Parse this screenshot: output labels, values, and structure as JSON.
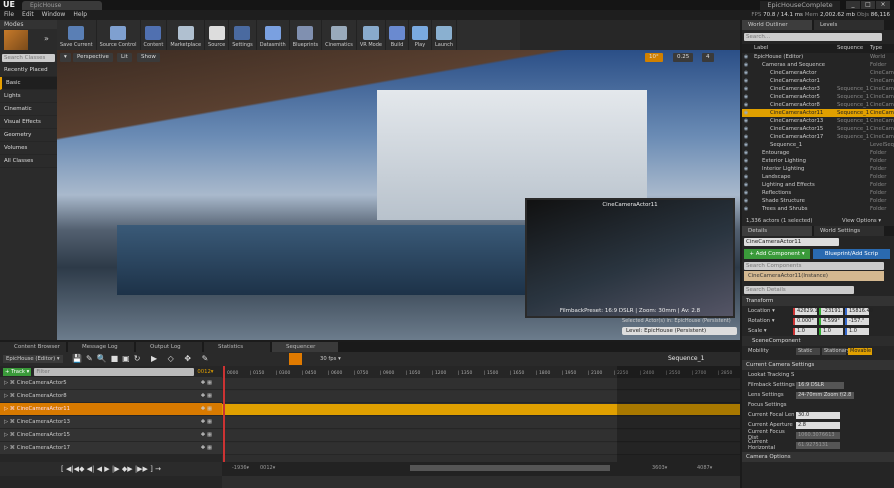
{
  "app": {
    "logo": "UE",
    "tab": "EpicHouse",
    "project": "EpicHouseComplete",
    "window_controls": [
      "_",
      "□",
      "×"
    ]
  },
  "menu": [
    "File",
    "Edit",
    "Window",
    "Help"
  ],
  "stats": {
    "fps_label": "FPS",
    "fps": "70.8 / 14.1 ms",
    "mem_label": "Mem",
    "mem": "2,002.62 mb",
    "objs_label": "Objs",
    "objs": "86,116"
  },
  "modes": {
    "title": "Modes",
    "search_placeholder": "Search Classes",
    "categories": [
      "Recently Placed",
      "Basic",
      "Lights",
      "Cinematic",
      "Visual Effects",
      "Geometry",
      "Volumes",
      "All Classes"
    ],
    "selected": "Basic"
  },
  "toolbar": [
    {
      "label": "Save Current",
      "color": "#5a7fb5"
    },
    {
      "label": "Source Control",
      "color": "#7fa0d0"
    },
    {
      "label": "Content",
      "color": "#5070b0"
    },
    {
      "label": "Marketplace",
      "color": "#b0c0d0"
    },
    {
      "label": "Source",
      "color": "#ddd"
    },
    {
      "label": "Settings",
      "color": "#4a6aa0"
    },
    {
      "label": "Datasmith",
      "color": "#7aa0e0"
    },
    {
      "label": "Blueprints",
      "color": "#8090b0"
    },
    {
      "label": "Cinematics",
      "color": "#9ab"
    },
    {
      "label": "VR Mode",
      "color": "#8ac"
    },
    {
      "label": "Build",
      "color": "#6a8ad0"
    },
    {
      "label": "Play",
      "color": "#7aaae0"
    },
    {
      "label": "Launch",
      "color": "#8ab0d0"
    }
  ],
  "viewport": {
    "menu": "▾",
    "perspective": "Perspective",
    "lit": "Lit",
    "show": "Show",
    "snap_angle": "10°",
    "scale": "0.25",
    "camera_speed": "4",
    "pip_title": "CineCameraActor11",
    "pip_info": "FilmbackPreset: 16:9 DSLR | Zoom: 30mm | Av: 2.8",
    "selected_actors": "Selected Actor(s) in: EpicHouse (Persistent)",
    "level": "Level: EpicHouse (Persistent)"
  },
  "outliner": {
    "tab": "World Outliner",
    "tab2": "Levels",
    "search_placeholder": "Search...",
    "columns": [
      "Label",
      "Sequence",
      "Type"
    ],
    "rows": [
      {
        "label": "EpicHouse (Editor)",
        "seq": "",
        "type": "World",
        "indent": 0,
        "sel": false
      },
      {
        "label": "Cameras and Sequence",
        "seq": "",
        "type": "Folder",
        "indent": 1,
        "sel": false
      },
      {
        "label": "CineCameraActor",
        "seq": "",
        "type": "CineCameraActor",
        "indent": 2,
        "sel": false
      },
      {
        "label": "CineCameraActor1",
        "seq": "",
        "type": "CineCameraActor",
        "indent": 2,
        "sel": false
      },
      {
        "label": "CineCameraActor3",
        "seq": "Sequence_1",
        "type": "CineCameraActor",
        "indent": 2,
        "sel": false
      },
      {
        "label": "CineCameraActor5",
        "seq": "Sequence_1",
        "type": "CineCameraActor",
        "indent": 2,
        "sel": false
      },
      {
        "label": "CineCameraActor8",
        "seq": "Sequence_1",
        "type": "CineCameraActor",
        "indent": 2,
        "sel": false
      },
      {
        "label": "CineCameraActor11",
        "seq": "Sequence_1",
        "type": "CineCameraActor",
        "indent": 2,
        "sel": true
      },
      {
        "label": "CineCameraActor13",
        "seq": "Sequence_1",
        "type": "CineCameraActor",
        "indent": 2,
        "sel": false
      },
      {
        "label": "CineCameraActor15",
        "seq": "Sequence_1",
        "type": "CineCameraActor",
        "indent": 2,
        "sel": false
      },
      {
        "label": "CineCameraActor17",
        "seq": "Sequence_1",
        "type": "CineCameraActor",
        "indent": 2,
        "sel": false
      },
      {
        "label": "Sequence_1",
        "seq": "",
        "type": "LevelSequenceActor",
        "indent": 2,
        "sel": false
      },
      {
        "label": "Entourage",
        "seq": "",
        "type": "Folder",
        "indent": 1,
        "sel": false
      },
      {
        "label": "Exterior Lighting",
        "seq": "",
        "type": "Folder",
        "indent": 1,
        "sel": false
      },
      {
        "label": "Interior Lighting",
        "seq": "",
        "type": "Folder",
        "indent": 1,
        "sel": false
      },
      {
        "label": "Landscape",
        "seq": "",
        "type": "Folder",
        "indent": 1,
        "sel": false
      },
      {
        "label": "Lighting and Effects",
        "seq": "",
        "type": "Folder",
        "indent": 1,
        "sel": false
      },
      {
        "label": "Reflections",
        "seq": "",
        "type": "Folder",
        "indent": 1,
        "sel": false
      },
      {
        "label": "Shade Structure",
        "seq": "",
        "type": "Folder",
        "indent": 1,
        "sel": false
      },
      {
        "label": "Trees and Shrubs",
        "seq": "",
        "type": "Folder",
        "indent": 1,
        "sel": false
      }
    ],
    "count": "1,336 actors (1 selected)",
    "view_options": "View Options ▾"
  },
  "details": {
    "tab": "Details",
    "tab2": "World Settings",
    "name": "CineCameraActor11",
    "add_component": "+ Add Component ▾",
    "blueprint": "Blueprint/Add Scrip",
    "search_components": "Search Components",
    "instance": "CineCameraActor11(Instance)",
    "search_details": "Search Details",
    "transform": "Transform",
    "location_label": "Location ▾",
    "location": [
      "42629.12",
      "-23191.1",
      "15816.40"
    ],
    "rotation_label": "Rotation ▾",
    "rotation": [
      "0.000°",
      "4.599°",
      "-157.°"
    ],
    "scale_label": "Scale ▾",
    "scale": [
      "1.0",
      "1.0",
      "1.0"
    ],
    "scene_component": "SceneComponent",
    "mobility_label": "Mobility",
    "mobility": [
      "Static",
      "Stationary",
      "Movable"
    ],
    "camera_settings": "Current Camera Settings",
    "lookat": "Lookat Tracking S",
    "filmback_label": "Filmback Settings",
    "filmback": "16:9 DSLR",
    "lens_label": "Lens Settings",
    "lens": "24-70mm Zoom f/2.8",
    "focus_label": "Focus Settings",
    "focal_label": "Current Focal Len",
    "focal": "30.0",
    "aperture_label": "Current Aperture",
    "aperture": "2.8",
    "focus_dist_label": "Current Focus Dist",
    "focus_dist": "1060.3076613",
    "horizontal_label": "Current Horizontal",
    "horizontal": "61.9275131",
    "camera_options": "Camera Options"
  },
  "bottom_tabs": [
    "Content Browser",
    "Message Log",
    "Output Log",
    "Statistics",
    "Sequencer"
  ],
  "sequencer": {
    "world": "EpicHouse (Editor) ▾",
    "fps": "30 fps ▾",
    "sequence": "Sequence_1",
    "track_btn": "+ Track ▾",
    "filter_placeholder": "Filter",
    "current_frame": "0012▾",
    "ticks": [
      "0000",
      "0150",
      "0300",
      "0450",
      "0600",
      "0750",
      "0900",
      "1050",
      "1200",
      "1350",
      "1500",
      "1650",
      "1800",
      "1950",
      "2100",
      "2250",
      "2400",
      "2550",
      "2700",
      "2850"
    ],
    "tracks": [
      {
        "label": "CineCameraActor5",
        "sel": false
      },
      {
        "label": "CineCameraActor8",
        "sel": false
      },
      {
        "label": "CineCameraActor11",
        "sel": true
      },
      {
        "label": "CineCameraActor13",
        "sel": false
      },
      {
        "label": "CineCameraActor15",
        "sel": false
      },
      {
        "label": "CineCameraActor17",
        "sel": false
      }
    ],
    "range_start": "-1936▾",
    "view_start": "0012▾",
    "view_end": "3603▾",
    "range_end": "4087▾",
    "transport": "[ ◀|◀◆ ◀| ◀ ▶ |▶ ◆▶ |▶▶ ] →"
  }
}
